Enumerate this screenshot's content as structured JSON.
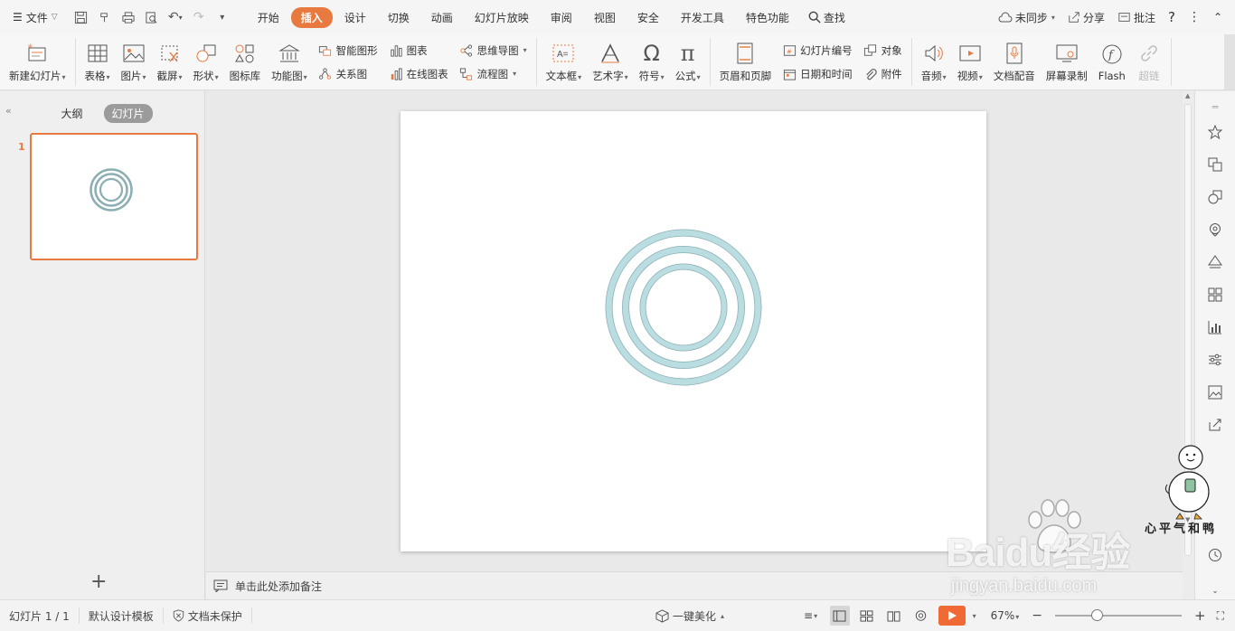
{
  "menubar": {
    "file_label": "文件",
    "tabs": [
      {
        "label": "开始",
        "active": false
      },
      {
        "label": "插入",
        "active": true
      },
      {
        "label": "设计",
        "active": false
      },
      {
        "label": "切换",
        "active": false
      },
      {
        "label": "动画",
        "active": false
      },
      {
        "label": "幻灯片放映",
        "active": false
      },
      {
        "label": "审阅",
        "active": false
      },
      {
        "label": "视图",
        "active": false
      },
      {
        "label": "安全",
        "active": false
      },
      {
        "label": "开发工具",
        "active": false
      },
      {
        "label": "特色功能",
        "active": false
      }
    ],
    "search_label": "查找",
    "sync_label": "未同步",
    "share_label": "分享",
    "comment_label": "批注"
  },
  "ribbon": {
    "new_slide": "新建幻灯片",
    "table": "表格",
    "picture": "图片",
    "screenshot": "截屏",
    "shape": "形状",
    "icon_lib": "图标库",
    "function_chart": "功能图",
    "smart_shape": "智能图形",
    "chart": "图表",
    "relation": "关系图",
    "online_chart": "在线图表",
    "mindmap": "思维导图",
    "flowchart": "流程图",
    "textbox": "文本框",
    "wordart": "艺术字",
    "symbol": "符号",
    "formula": "公式",
    "header_footer": "页眉和页脚",
    "slide_number": "幻灯片编号",
    "object": "对象",
    "datetime": "日期和时间",
    "attachment": "附件",
    "audio": "音频",
    "video": "视频",
    "doc_audio": "文档配音",
    "screen_record": "屏幕录制",
    "flash": "Flash",
    "hyperlink": "超链"
  },
  "leftpane": {
    "tab_outline": "大纲",
    "tab_slides": "幻灯片",
    "slide_number": "1"
  },
  "notes": {
    "placeholder": "单击此处添加备注"
  },
  "statusbar": {
    "slide_count": "幻灯片 1 / 1",
    "template": "默认设计模板",
    "protection": "文档未保护",
    "beautify": "一键美化",
    "zoom": "67%"
  },
  "watermark": {
    "brand": "Baidu经验",
    "url": "jingyan.baidu.com",
    "mascot_text": "心平气和鸭"
  },
  "colors": {
    "accent": "#e87a3f",
    "ring_fill": "#b9dde1",
    "ring_stroke": "#8aaeb2"
  }
}
